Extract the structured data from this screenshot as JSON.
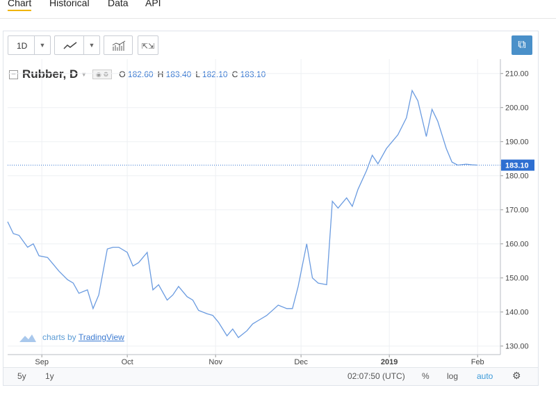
{
  "tabs": [
    "Chart",
    "Historical",
    "Data",
    "API"
  ],
  "toolbar": {
    "interval": "1D",
    "line_icon": "line-chart-icon",
    "indicators_icon": "indicators-icon",
    "fullscreen_icon": "fullscreen-icon"
  },
  "legend": {
    "symbol": "Rubber, D",
    "o_label": "O",
    "o": "182.60",
    "h_label": "H",
    "h": "183.40",
    "l_label": "L",
    "l": "182.10",
    "c_label": "C",
    "c": "183.10"
  },
  "price_tag": "183.10",
  "watermark": {
    "prefix": "charts by",
    "link": "TradingView"
  },
  "bottom": {
    "range_5y": "5y",
    "range_1y": "1y",
    "time": "02:07:50 (UTC)",
    "percent": "%",
    "log": "log",
    "auto": "auto"
  },
  "colors": {
    "line": "#6a9be0",
    "price_line": "#3b7ad1",
    "price_tag_bg": "#2e6fd1",
    "accent": "#4a90c9"
  },
  "chart_data": {
    "type": "line",
    "x_ticks": [
      {
        "label": "Sep",
        "date": "2018-09-01"
      },
      {
        "label": "Oct",
        "date": "2018-10-01"
      },
      {
        "label": "Nov",
        "date": "2018-11-01"
      },
      {
        "label": "Dec",
        "date": "2018-12-01"
      },
      {
        "label": "2019",
        "date": "2019-01-01"
      },
      {
        "label": "Feb",
        "date": "2019-02-01"
      }
    ],
    "y_ticks": [
      "130.00",
      "140.00",
      "150.00",
      "160.00",
      "170.00",
      "180.00",
      "190.00",
      "200.00",
      "210.00"
    ],
    "ylim": [
      127.5,
      213
    ],
    "xlim": [
      "2018-08-20",
      "2019-02-09"
    ],
    "current": 183.1,
    "series": [
      {
        "x": [
          "2018-08-20",
          "2018-08-22",
          "2018-08-24",
          "2018-08-27",
          "2018-08-29",
          "2018-08-31",
          "2018-09-03",
          "2018-09-05",
          "2018-09-07",
          "2018-09-10",
          "2018-09-12",
          "2018-09-14",
          "2018-09-17",
          "2018-09-19",
          "2018-09-21",
          "2018-09-24",
          "2018-09-26",
          "2018-09-28",
          "2018-10-01",
          "2018-10-03",
          "2018-10-05",
          "2018-10-08",
          "2018-10-10",
          "2018-10-12",
          "2018-10-15",
          "2018-10-17",
          "2018-10-19",
          "2018-10-22",
          "2018-10-24",
          "2018-10-26",
          "2018-10-29",
          "2018-10-31",
          "2018-11-02",
          "2018-11-05",
          "2018-11-07",
          "2018-11-09",
          "2018-11-12",
          "2018-11-14",
          "2018-11-16",
          "2018-11-19",
          "2018-11-21",
          "2018-11-23",
          "2018-11-26",
          "2018-11-28",
          "2018-11-30",
          "2018-12-03",
          "2018-12-05",
          "2018-12-07",
          "2018-12-10",
          "2018-12-12",
          "2018-12-14",
          "2018-12-17",
          "2018-12-19",
          "2018-12-21",
          "2018-12-24",
          "2018-12-26",
          "2018-12-28",
          "2018-12-31",
          "2019-01-02",
          "2019-01-04",
          "2019-01-07",
          "2019-01-09",
          "2019-01-11",
          "2019-01-14",
          "2019-01-16",
          "2019-01-18",
          "2019-01-21",
          "2019-01-23",
          "2019-01-25",
          "2019-01-28",
          "2019-01-30",
          "2019-02-01"
        ],
        "values": [
          166.5,
          163.0,
          162.5,
          159.0,
          160.0,
          156.5,
          156.0,
          154.0,
          152.0,
          149.5,
          148.5,
          145.5,
          146.5,
          141.0,
          145.0,
          158.5,
          159.0,
          159.0,
          157.5,
          153.5,
          154.5,
          157.5,
          146.5,
          148.0,
          143.5,
          145.0,
          147.5,
          144.5,
          143.5,
          140.5,
          139.5,
          139.0,
          137.0,
          133.0,
          135.0,
          132.5,
          134.5,
          136.5,
          137.5,
          139.0,
          140.5,
          142.0,
          141.0,
          141.0,
          147.5,
          160.0,
          150.0,
          148.5,
          148.0,
          172.5,
          170.5,
          173.5,
          171.0,
          176.0,
          181.5,
          186.0,
          183.5,
          188.0,
          190.0,
          192.0,
          197.0,
          205.0,
          202.0,
          191.5,
          199.5,
          196.0,
          188.0,
          184.0,
          183.1,
          183.4,
          183.2,
          183.1
        ]
      }
    ]
  }
}
